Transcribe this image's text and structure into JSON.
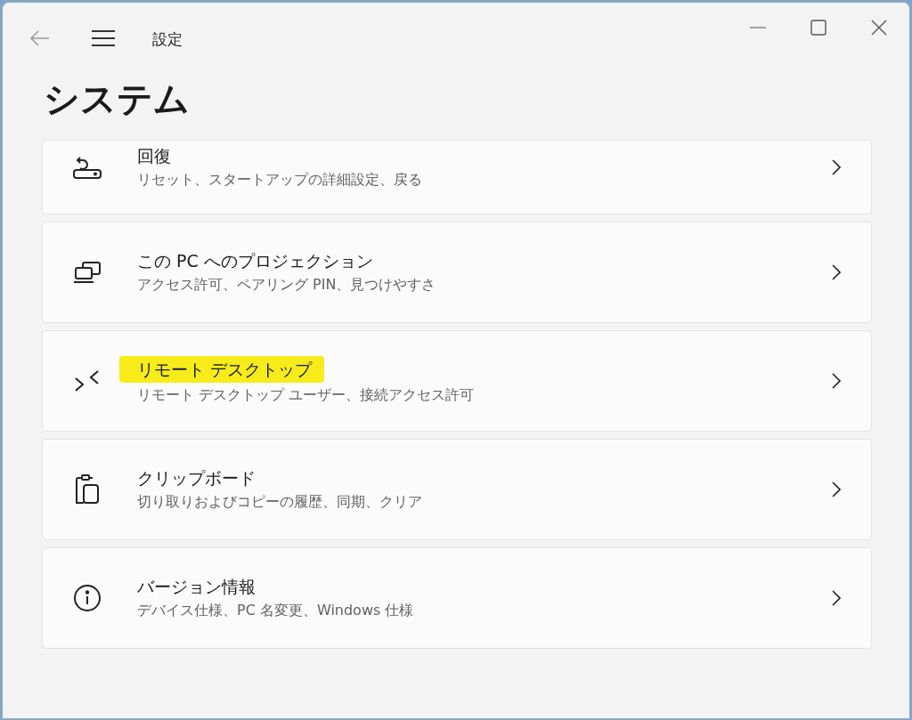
{
  "window": {
    "app_title": "設定"
  },
  "page_title": "システム",
  "items": [
    {
      "kind": "recovery",
      "title": "回復",
      "subtitle": "リセット、スタートアップの詳細設定、戻る",
      "highlighted": false
    },
    {
      "kind": "projection",
      "title": "この PC へのプロジェクション",
      "subtitle": "アクセス許可、ペアリング PIN、見つけやすさ",
      "highlighted": false
    },
    {
      "kind": "remote",
      "title": "リモート デスクトップ",
      "subtitle": "リモート デスクトップ ユーザー、接続アクセス許可",
      "highlighted": true
    },
    {
      "kind": "clipboard",
      "title": "クリップボード",
      "subtitle": "切り取りおよびコピーの履歴、同期、クリア",
      "highlighted": false
    },
    {
      "kind": "info",
      "title": "バージョン情報",
      "subtitle": "デバイス仕様、PC 名変更、Windows 仕様",
      "highlighted": false
    }
  ]
}
